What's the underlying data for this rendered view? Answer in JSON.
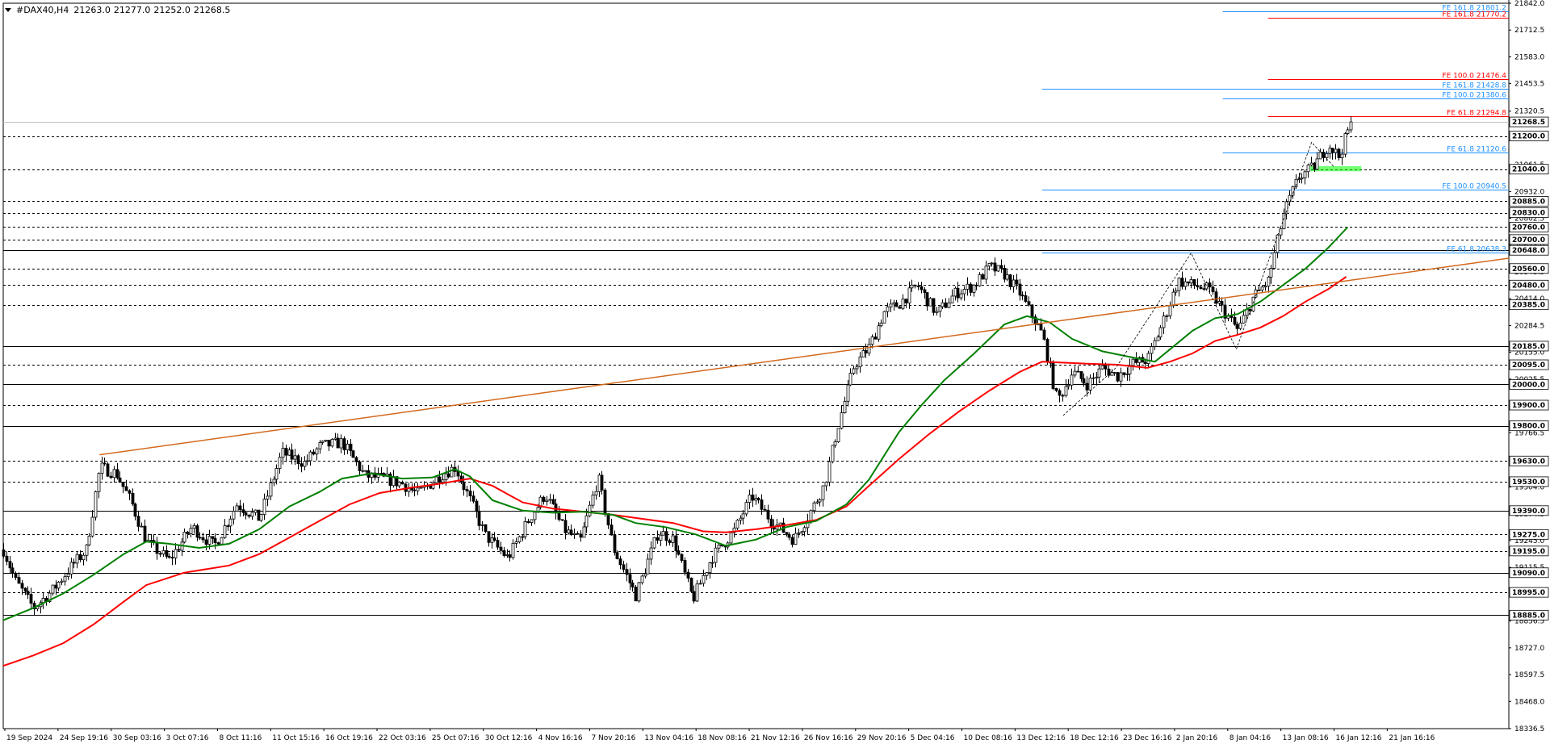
{
  "header": {
    "symbol": "#DAX40,H4",
    "open": "21263.0",
    "high": "21277.0",
    "low": "21252.0",
    "close": "21268.5"
  },
  "colors": {
    "bull_body": "#ffffff",
    "bear_body": "#000000",
    "candle_outline": "#000000",
    "ma_fast": "#008000",
    "ma_slow": "#ff0000",
    "trendline": "#d2691e",
    "fib_blue": "#1e90ff",
    "fib_red": "#ff0000",
    "current_price_label_bg": "#ffffff",
    "highlight_zone": "#00ff00"
  },
  "chart_data": {
    "type": "candlestick",
    "symbol": "#DAX40",
    "timeframe": "H4",
    "ylim": [
      18336.5,
      21842.0
    ],
    "x_tick_labels": [
      "19 Sep 2024",
      "24 Sep 19:16",
      "30 Sep 03:16",
      "3 Oct 07:16",
      "8 Oct 11:16",
      "11 Oct 15:16",
      "16 Oct 19:16",
      "22 Oct 03:16",
      "25 Oct 07:16",
      "30 Oct 12:16",
      "4 Nov 16:16",
      "7 Nov 20:16",
      "13 Nov 04:16",
      "18 Nov 08:16",
      "21 Nov 12:16",
      "26 Nov 16:16",
      "29 Nov 20:16",
      "5 Dec 04:16",
      "10 Dec 08:16",
      "13 Dec 12:16",
      "18 Dec 12:16",
      "23 Dec 16:16",
      "2 Jan 20:16",
      "8 Jan 04:16",
      "13 Jan 08:16",
      "16 Jan 12:16",
      "21 Jan 16:16"
    ],
    "y_axis_ticks": [
      "21842.0",
      "21712.5",
      "21583.0",
      "21453.5",
      "21320.5",
      "21191.0",
      "21061.5",
      "20932.0",
      "20802.5",
      "20673.0",
      "20543.5",
      "20414.0",
      "20284.5",
      "20155.0",
      "20025.5",
      "19896.0",
      "19766.5",
      "19633.5",
      "19504.0",
      "19374.5",
      "19245.0",
      "19115.5",
      "18986.0",
      "18856.5",
      "18727.0",
      "18597.5",
      "18468.0",
      "18336.5"
    ],
    "horizontal_levels": [
      {
        "value": 21200.0,
        "label": "21200.0",
        "style": "dashed"
      },
      {
        "value": 21040.0,
        "label": "21040.0",
        "style": "dashed"
      },
      {
        "value": 20885.0,
        "label": "20885.0",
        "style": "dashed"
      },
      {
        "value": 20830.0,
        "label": "20830.0",
        "style": "dashed"
      },
      {
        "value": 20760.0,
        "label": "20760.0",
        "style": "dashed"
      },
      {
        "value": 20700.0,
        "label": "20700.0",
        "style": "dashed"
      },
      {
        "value": 20648.0,
        "label": "20648.0",
        "style": "solid"
      },
      {
        "value": 20560.0,
        "label": "20560.0",
        "style": "dashed"
      },
      {
        "value": 20480.0,
        "label": "20480.0",
        "style": "dashed"
      },
      {
        "value": 20385.0,
        "label": "20385.0",
        "style": "dashed"
      },
      {
        "value": 20185.0,
        "label": "20185.0",
        "style": "solid"
      },
      {
        "value": 20095.0,
        "label": "20095.0",
        "style": "dashed"
      },
      {
        "value": 20000.0,
        "label": "20000.0",
        "style": "solid"
      },
      {
        "value": 19900.0,
        "label": "19900.0",
        "style": "dashed"
      },
      {
        "value": 19800.0,
        "label": "19800.0",
        "style": "solid"
      },
      {
        "value": 19630.0,
        "label": "19630.0",
        "style": "dashed"
      },
      {
        "value": 19530.0,
        "label": "19530.0",
        "style": "dashed"
      },
      {
        "value": 19390.0,
        "label": "19390.0",
        "style": "solid"
      },
      {
        "value": 19275.0,
        "label": "19275.0",
        "style": "dashed"
      },
      {
        "value": 19195.0,
        "label": "19195.0",
        "style": "dashed"
      },
      {
        "value": 19090.0,
        "label": "19090.0",
        "style": "solid"
      },
      {
        "value": 18995.0,
        "label": "18995.0",
        "style": "dashed"
      },
      {
        "value": 18885.0,
        "label": "18885.0",
        "style": "solid"
      }
    ],
    "current_price": {
      "value": 21268.5,
      "label": "21268.5"
    },
    "fib_levels": [
      {
        "label": "FE 161.8 21801.2",
        "value": 21801.2,
        "color": "blue",
        "x_start": 0.81
      },
      {
        "label": "FE 161.8 21770.2",
        "value": 21770.2,
        "color": "red",
        "x_start": 0.84
      },
      {
        "label": "FE 100.0 21476.4",
        "value": 21476.4,
        "color": "red",
        "x_start": 0.84
      },
      {
        "label": "FE 161.8 21428.8",
        "value": 21428.8,
        "color": "blue",
        "x_start": 0.69
      },
      {
        "label": "FE 100.0 21380.6",
        "value": 21380.6,
        "color": "blue",
        "x_start": 0.81
      },
      {
        "label": "FE 61.8 21294.8",
        "value": 21294.8,
        "color": "red",
        "x_start": 0.84
      },
      {
        "label": "FE 61.8 21120.6",
        "value": 21120.6,
        "color": "blue",
        "x_start": 0.81
      },
      {
        "label": "FE 100.0 20940.5",
        "value": 20940.5,
        "color": "blue",
        "x_start": 0.69
      },
      {
        "label": "FE 61.8 20638.3",
        "value": 20638.3,
        "color": "blue",
        "x_start": 0.69
      }
    ],
    "trendline": {
      "from": {
        "x": 0.064,
        "y": 19660
      },
      "to": {
        "x": 1.0,
        "y": 20610
      }
    },
    "zigzag": [
      {
        "x": 0.704,
        "y": 19850
      },
      {
        "x": 0.739,
        "y": 20080
      },
      {
        "x": 0.789,
        "y": 20635
      },
      {
        "x": 0.819,
        "y": 20170
      },
      {
        "x": 0.869,
        "y": 21170
      },
      {
        "x": 0.884,
        "y": 21050
      }
    ],
    "highlight_zone": {
      "x": [
        0.868,
        0.902
      ],
      "y": [
        21030,
        21055
      ]
    },
    "ma_fast_points": [
      [
        0,
        18860
      ],
      [
        0.02,
        18920
      ],
      [
        0.04,
        18990
      ],
      [
        0.06,
        19080
      ],
      [
        0.08,
        19180
      ],
      [
        0.095,
        19240
      ],
      [
        0.11,
        19230
      ],
      [
        0.13,
        19210
      ],
      [
        0.15,
        19230
      ],
      [
        0.17,
        19300
      ],
      [
        0.19,
        19410
      ],
      [
        0.21,
        19480
      ],
      [
        0.225,
        19545
      ],
      [
        0.245,
        19570
      ],
      [
        0.265,
        19545
      ],
      [
        0.285,
        19550
      ],
      [
        0.3,
        19590
      ],
      [
        0.31,
        19555
      ],
      [
        0.325,
        19440
      ],
      [
        0.345,
        19390
      ],
      [
        0.365,
        19380
      ],
      [
        0.385,
        19385
      ],
      [
        0.405,
        19370
      ],
      [
        0.42,
        19330
      ],
      [
        0.44,
        19310
      ],
      [
        0.46,
        19275
      ],
      [
        0.48,
        19220
      ],
      [
        0.5,
        19250
      ],
      [
        0.52,
        19310
      ],
      [
        0.54,
        19340
      ],
      [
        0.56,
        19420
      ],
      [
        0.575,
        19540
      ],
      [
        0.595,
        19770
      ],
      [
        0.61,
        19900
      ],
      [
        0.625,
        20020
      ],
      [
        0.645,
        20150
      ],
      [
        0.665,
        20290
      ],
      [
        0.68,
        20330
      ],
      [
        0.695,
        20300
      ],
      [
        0.71,
        20220
      ],
      [
        0.73,
        20160
      ],
      [
        0.75,
        20130
      ],
      [
        0.765,
        20110
      ],
      [
        0.775,
        20170
      ],
      [
        0.79,
        20260
      ],
      [
        0.805,
        20320
      ],
      [
        0.82,
        20340
      ],
      [
        0.835,
        20400
      ],
      [
        0.85,
        20480
      ],
      [
        0.865,
        20560
      ],
      [
        0.88,
        20660
      ],
      [
        0.893,
        20760
      ]
    ],
    "ma_slow_points": [
      [
        0,
        18640
      ],
      [
        0.02,
        18690
      ],
      [
        0.04,
        18750
      ],
      [
        0.06,
        18840
      ],
      [
        0.08,
        18950
      ],
      [
        0.095,
        19030
      ],
      [
        0.12,
        19090
      ],
      [
        0.15,
        19125
      ],
      [
        0.17,
        19180
      ],
      [
        0.19,
        19260
      ],
      [
        0.21,
        19340
      ],
      [
        0.23,
        19420
      ],
      [
        0.25,
        19475
      ],
      [
        0.27,
        19500
      ],
      [
        0.29,
        19520
      ],
      [
        0.31,
        19545
      ],
      [
        0.325,
        19510
      ],
      [
        0.345,
        19430
      ],
      [
        0.365,
        19400
      ],
      [
        0.385,
        19385
      ],
      [
        0.405,
        19370
      ],
      [
        0.425,
        19350
      ],
      [
        0.445,
        19330
      ],
      [
        0.465,
        19290
      ],
      [
        0.48,
        19285
      ],
      [
        0.5,
        19300
      ],
      [
        0.52,
        19320
      ],
      [
        0.54,
        19345
      ],
      [
        0.56,
        19410
      ],
      [
        0.575,
        19510
      ],
      [
        0.595,
        19640
      ],
      [
        0.615,
        19760
      ],
      [
        0.635,
        19870
      ],
      [
        0.655,
        19970
      ],
      [
        0.675,
        20060
      ],
      [
        0.69,
        20110
      ],
      [
        0.705,
        20105
      ],
      [
        0.72,
        20100
      ],
      [
        0.74,
        20095
      ],
      [
        0.76,
        20080
      ],
      [
        0.775,
        20110
      ],
      [
        0.79,
        20150
      ],
      [
        0.805,
        20210
      ],
      [
        0.82,
        20240
      ],
      [
        0.835,
        20275
      ],
      [
        0.85,
        20330
      ],
      [
        0.865,
        20400
      ],
      [
        0.88,
        20460
      ],
      [
        0.892,
        20520
      ]
    ],
    "price_path_anchors": [
      [
        0,
        19200
      ],
      [
        0.008,
        19050
      ],
      [
        0.02,
        18920
      ],
      [
        0.032,
        19000
      ],
      [
        0.045,
        19120
      ],
      [
        0.055,
        19200
      ],
      [
        0.064,
        19600
      ],
      [
        0.075,
        19570
      ],
      [
        0.085,
        19430
      ],
      [
        0.095,
        19240
      ],
      [
        0.11,
        19150
      ],
      [
        0.125,
        19310
      ],
      [
        0.14,
        19220
      ],
      [
        0.155,
        19420
      ],
      [
        0.17,
        19350
      ],
      [
        0.185,
        19670
      ],
      [
        0.2,
        19620
      ],
      [
        0.21,
        19700
      ],
      [
        0.225,
        19720
      ],
      [
        0.24,
        19560
      ],
      [
        0.255,
        19540
      ],
      [
        0.265,
        19520
      ],
      [
        0.275,
        19470
      ],
      [
        0.29,
        19560
      ],
      [
        0.3,
        19600
      ],
      [
        0.31,
        19440
      ],
      [
        0.32,
        19270
      ],
      [
        0.335,
        19160
      ],
      [
        0.35,
        19360
      ],
      [
        0.36,
        19470
      ],
      [
        0.372,
        19300
      ],
      [
        0.383,
        19240
      ],
      [
        0.395,
        19550
      ],
      [
        0.405,
        19210
      ],
      [
        0.42,
        18980
      ],
      [
        0.435,
        19290
      ],
      [
        0.445,
        19250
      ],
      [
        0.458,
        18960
      ],
      [
        0.47,
        19160
      ],
      [
        0.485,
        19290
      ],
      [
        0.497,
        19460
      ],
      [
        0.51,
        19340
      ],
      [
        0.525,
        19250
      ],
      [
        0.535,
        19370
      ],
      [
        0.545,
        19510
      ],
      [
        0.555,
        19820
      ],
      [
        0.565,
        20090
      ],
      [
        0.575,
        20180
      ],
      [
        0.585,
        20350
      ],
      [
        0.595,
        20390
      ],
      [
        0.607,
        20480
      ],
      [
        0.62,
        20340
      ],
      [
        0.632,
        20440
      ],
      [
        0.645,
        20480
      ],
      [
        0.655,
        20570
      ],
      [
        0.665,
        20530
      ],
      [
        0.675,
        20440
      ],
      [
        0.69,
        20240
      ],
      [
        0.7,
        19920
      ],
      [
        0.71,
        20060
      ],
      [
        0.72,
        20000
      ],
      [
        0.73,
        20080
      ],
      [
        0.74,
        20040
      ],
      [
        0.75,
        20100
      ],
      [
        0.76,
        20120
      ],
      [
        0.77,
        20300
      ],
      [
        0.78,
        20500
      ],
      [
        0.79,
        20480
      ],
      [
        0.8,
        20460
      ],
      [
        0.81,
        20360
      ],
      [
        0.82,
        20260
      ],
      [
        0.83,
        20420
      ],
      [
        0.84,
        20500
      ],
      [
        0.85,
        20820
      ],
      [
        0.86,
        21000
      ],
      [
        0.87,
        21050
      ],
      [
        0.88,
        21160
      ],
      [
        0.887,
        21100
      ],
      [
        0.895,
        21268.5
      ]
    ]
  }
}
